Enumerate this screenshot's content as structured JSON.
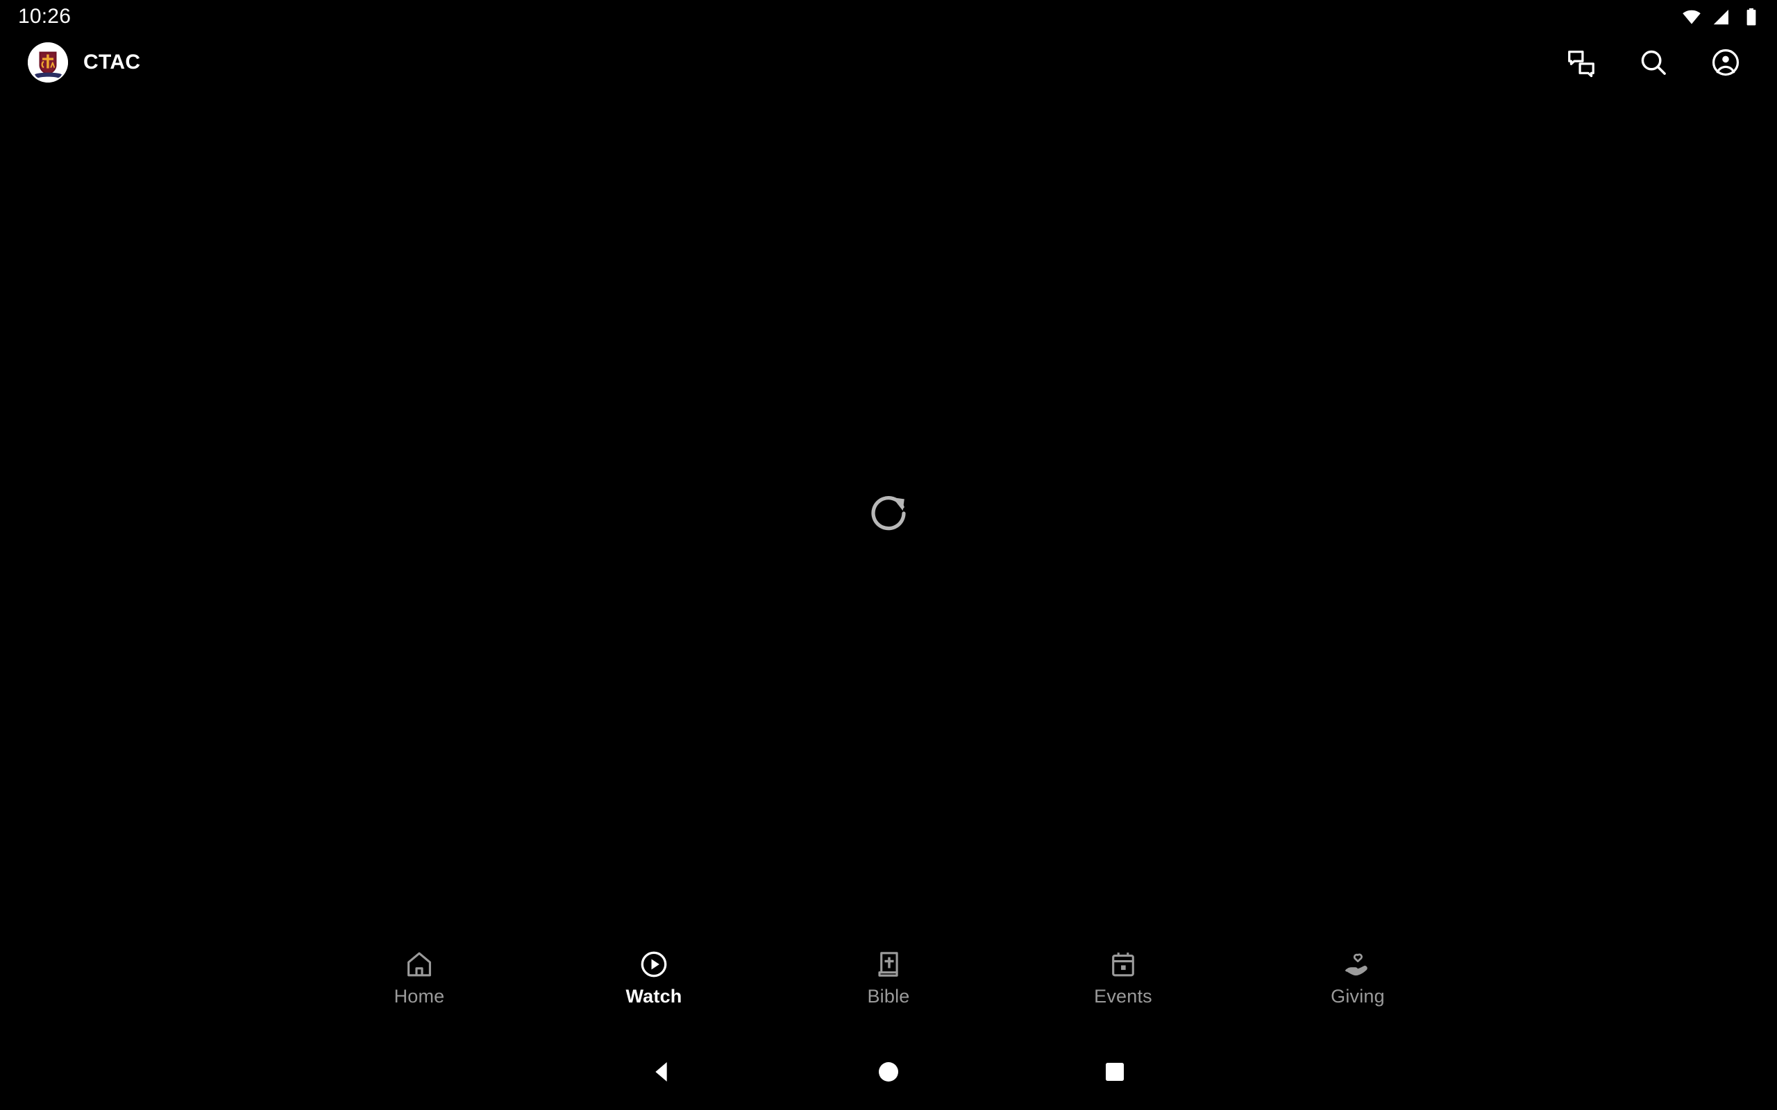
{
  "status_bar": {
    "time": "10:26",
    "icons": [
      "wifi-icon",
      "cellular-signal-icon",
      "battery-full-icon"
    ]
  },
  "header": {
    "logo_name": "ctac-shield-logo",
    "title": "CTAC",
    "actions": [
      {
        "name": "chat-icon",
        "label": "Chat"
      },
      {
        "name": "search-icon",
        "label": "Search"
      },
      {
        "name": "account-circle-icon",
        "label": "Account"
      }
    ]
  },
  "main": {
    "state": "empty",
    "refresh_icon": "refresh-icon",
    "refresh_label": "Reload"
  },
  "tab_bar": {
    "active_index": 1,
    "tabs": [
      {
        "label": "Home",
        "icon": "home-icon"
      },
      {
        "label": "Watch",
        "icon": "play-circle-icon"
      },
      {
        "label": "Bible",
        "icon": "book-cross-icon"
      },
      {
        "label": "Events",
        "icon": "calendar-icon"
      },
      {
        "label": "Giving",
        "icon": "hand-heart-icon"
      }
    ]
  },
  "system_nav": {
    "buttons": [
      {
        "name": "android-back-button",
        "label": "Back"
      },
      {
        "name": "android-home-button",
        "label": "Home"
      },
      {
        "name": "android-recents-button",
        "label": "Recents"
      }
    ]
  },
  "colors": {
    "background": "#000000",
    "accent_white": "#ffffff",
    "inactive_grey": "#9b9b9b",
    "refresh_grey": "#b8b8b8",
    "logo_shield": "#6e1124",
    "logo_gold": "#f0a830",
    "logo_banner": "#2b2f63"
  }
}
